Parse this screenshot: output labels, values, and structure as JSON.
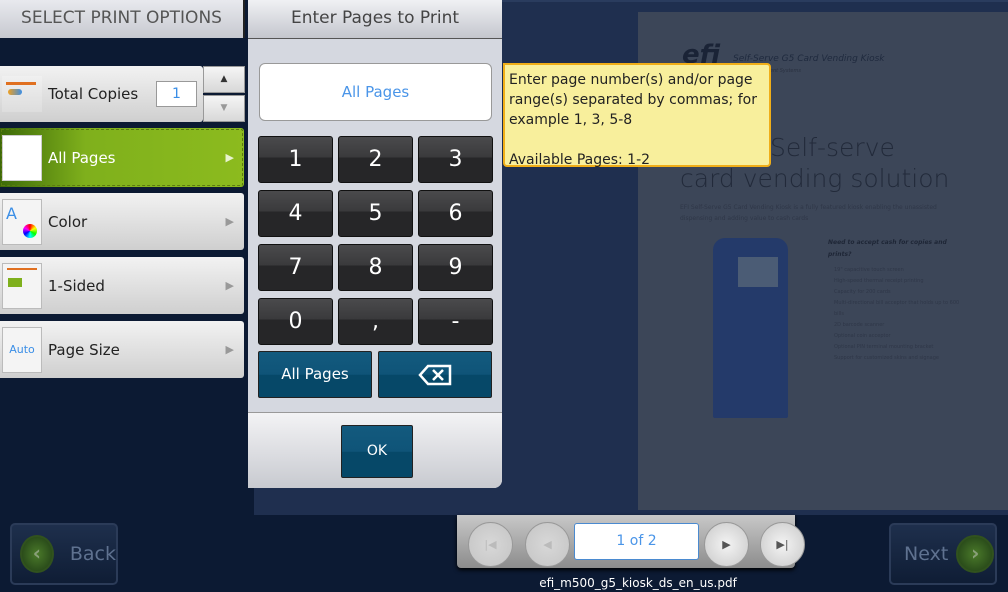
{
  "left_panel": {
    "title": "SELECT PRINT OPTIONS",
    "total_copies": {
      "label": "Total Copies",
      "value": "1",
      "up": "▲",
      "down": "▼"
    },
    "options": [
      {
        "label": "All Pages",
        "selected": true,
        "icon": "pages-icon"
      },
      {
        "label": "Color",
        "selected": false,
        "icon": "color-icon"
      },
      {
        "label": "1-Sided",
        "selected": false,
        "icon": "one-sided-icon"
      },
      {
        "label": "Page Size",
        "selected": false,
        "icon": "page-size-icon",
        "icon_text": "Auto"
      }
    ],
    "arrow": "▶"
  },
  "keypad": {
    "title": "Enter Pages to Print",
    "input_value": "All Pages",
    "keys": [
      "1",
      "2",
      "3",
      "4",
      "5",
      "6",
      "7",
      "8",
      "9",
      "0",
      ",",
      "-"
    ],
    "all_pages_label": "All Pages",
    "backspace_icon": "backspace-icon",
    "ok_label": "OK"
  },
  "tooltip": {
    "text": "Enter page number(s) and/or page range(s) separated by commas; for example 1, 3, 5-8",
    "available": "Available Pages: 1-2"
  },
  "document": {
    "logo": "efi",
    "header": "Self-Serve G5 Card Vending Kiosk",
    "subheader": "Payment Systems",
    "headline1": "Self-serve",
    "headline2": "card vending solution",
    "intro": "EFI Self-Serve G5 Card Vending Kiosk is a fully featured kiosk enabling the unassisted dispensing and adding value to cash cards",
    "side_title": "Need to accept cash for copies and prints?",
    "side_items": [
      "19\" capacitive touch screen",
      "High-speed thermal receipt printing",
      "Capacity for 200 cards",
      "Multi-directional bill acceptor that holds up to 600 bills",
      "2D barcode scanner",
      "Optional coin acceptor",
      "Optional PIN terminal mounting bracket",
      "Support for customized skins and signage"
    ]
  },
  "nav": {
    "back": "Back",
    "next": "Next"
  },
  "pager": {
    "page_display": "1 of 2",
    "current_page": 1,
    "total_pages": 2,
    "filename": "efi_m500_g5_kiosk_ds_en_us.pdf"
  },
  "colors": {
    "accent_green": "#8cbb1e",
    "key_blue": "#064868",
    "tooltip_bg": "#f8ef9c",
    "tooltip_border": "#f0ae18",
    "background": "#0c1a33"
  }
}
